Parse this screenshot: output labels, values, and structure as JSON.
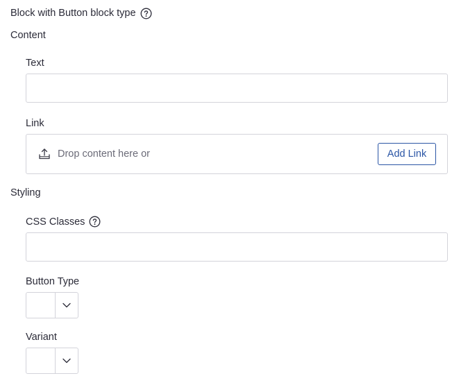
{
  "header": {
    "title": "Block with Button block type",
    "help_icon": "help-circle-icon"
  },
  "sections": {
    "content_label": "Content",
    "styling_label": "Styling"
  },
  "fields": {
    "text": {
      "label": "Text",
      "value": "",
      "placeholder": ""
    },
    "link": {
      "label": "Link",
      "drop_text": "Drop content here or",
      "icon": "upload-icon",
      "add_link_label": "Add Link"
    },
    "css_classes": {
      "label": "CSS Classes",
      "value": "",
      "placeholder": "",
      "help_icon": "help-circle-icon"
    },
    "button_type": {
      "label": "Button Type",
      "selected": "",
      "toggle_icon": "chevron-down-icon"
    },
    "variant": {
      "label": "Variant",
      "selected": "",
      "toggle_icon": "chevron-down-icon"
    }
  },
  "colors": {
    "accent": "#2a55a5",
    "border": "#d3d3da",
    "text": "#2b2b38",
    "muted_text": "#6b6b78"
  }
}
